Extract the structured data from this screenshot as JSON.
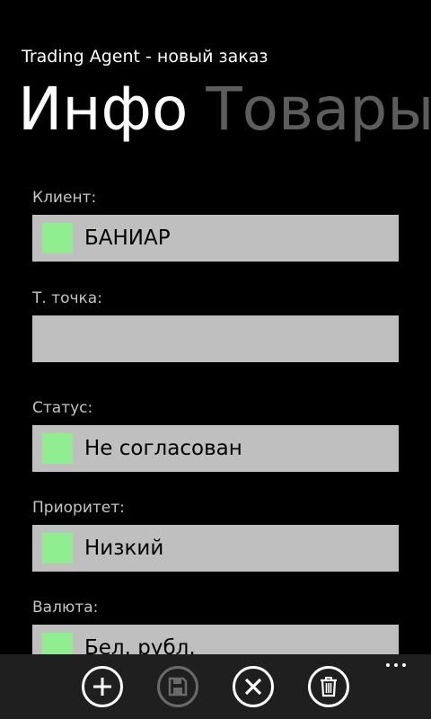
{
  "app": {
    "title": "Trading Agent - новый заказ"
  },
  "pivot": {
    "tabs": [
      {
        "label": "Инфо",
        "active": true
      },
      {
        "label": "Товары",
        "active": false
      }
    ]
  },
  "form": {
    "fields": [
      {
        "label": "Клиент:",
        "value": "БАНИАР",
        "has_swatch": true
      },
      {
        "label": "Т. точка:",
        "value": "",
        "has_swatch": false
      },
      {
        "label": "Статус:",
        "value": "Не согласован",
        "has_swatch": true
      },
      {
        "label": "Приоритет:",
        "value": "Низкий",
        "has_swatch": true
      },
      {
        "label": "Валюта:",
        "value": "Бел. рубл.",
        "has_swatch": true
      }
    ],
    "swatch_color": "#90ee90"
  },
  "appbar": {
    "buttons": [
      {
        "icon": "add-icon",
        "enabled": true
      },
      {
        "icon": "save-icon",
        "enabled": false
      },
      {
        "icon": "cancel-icon",
        "enabled": true
      },
      {
        "icon": "delete-icon",
        "enabled": true
      }
    ],
    "more_icon": "ellipsis-icon"
  }
}
